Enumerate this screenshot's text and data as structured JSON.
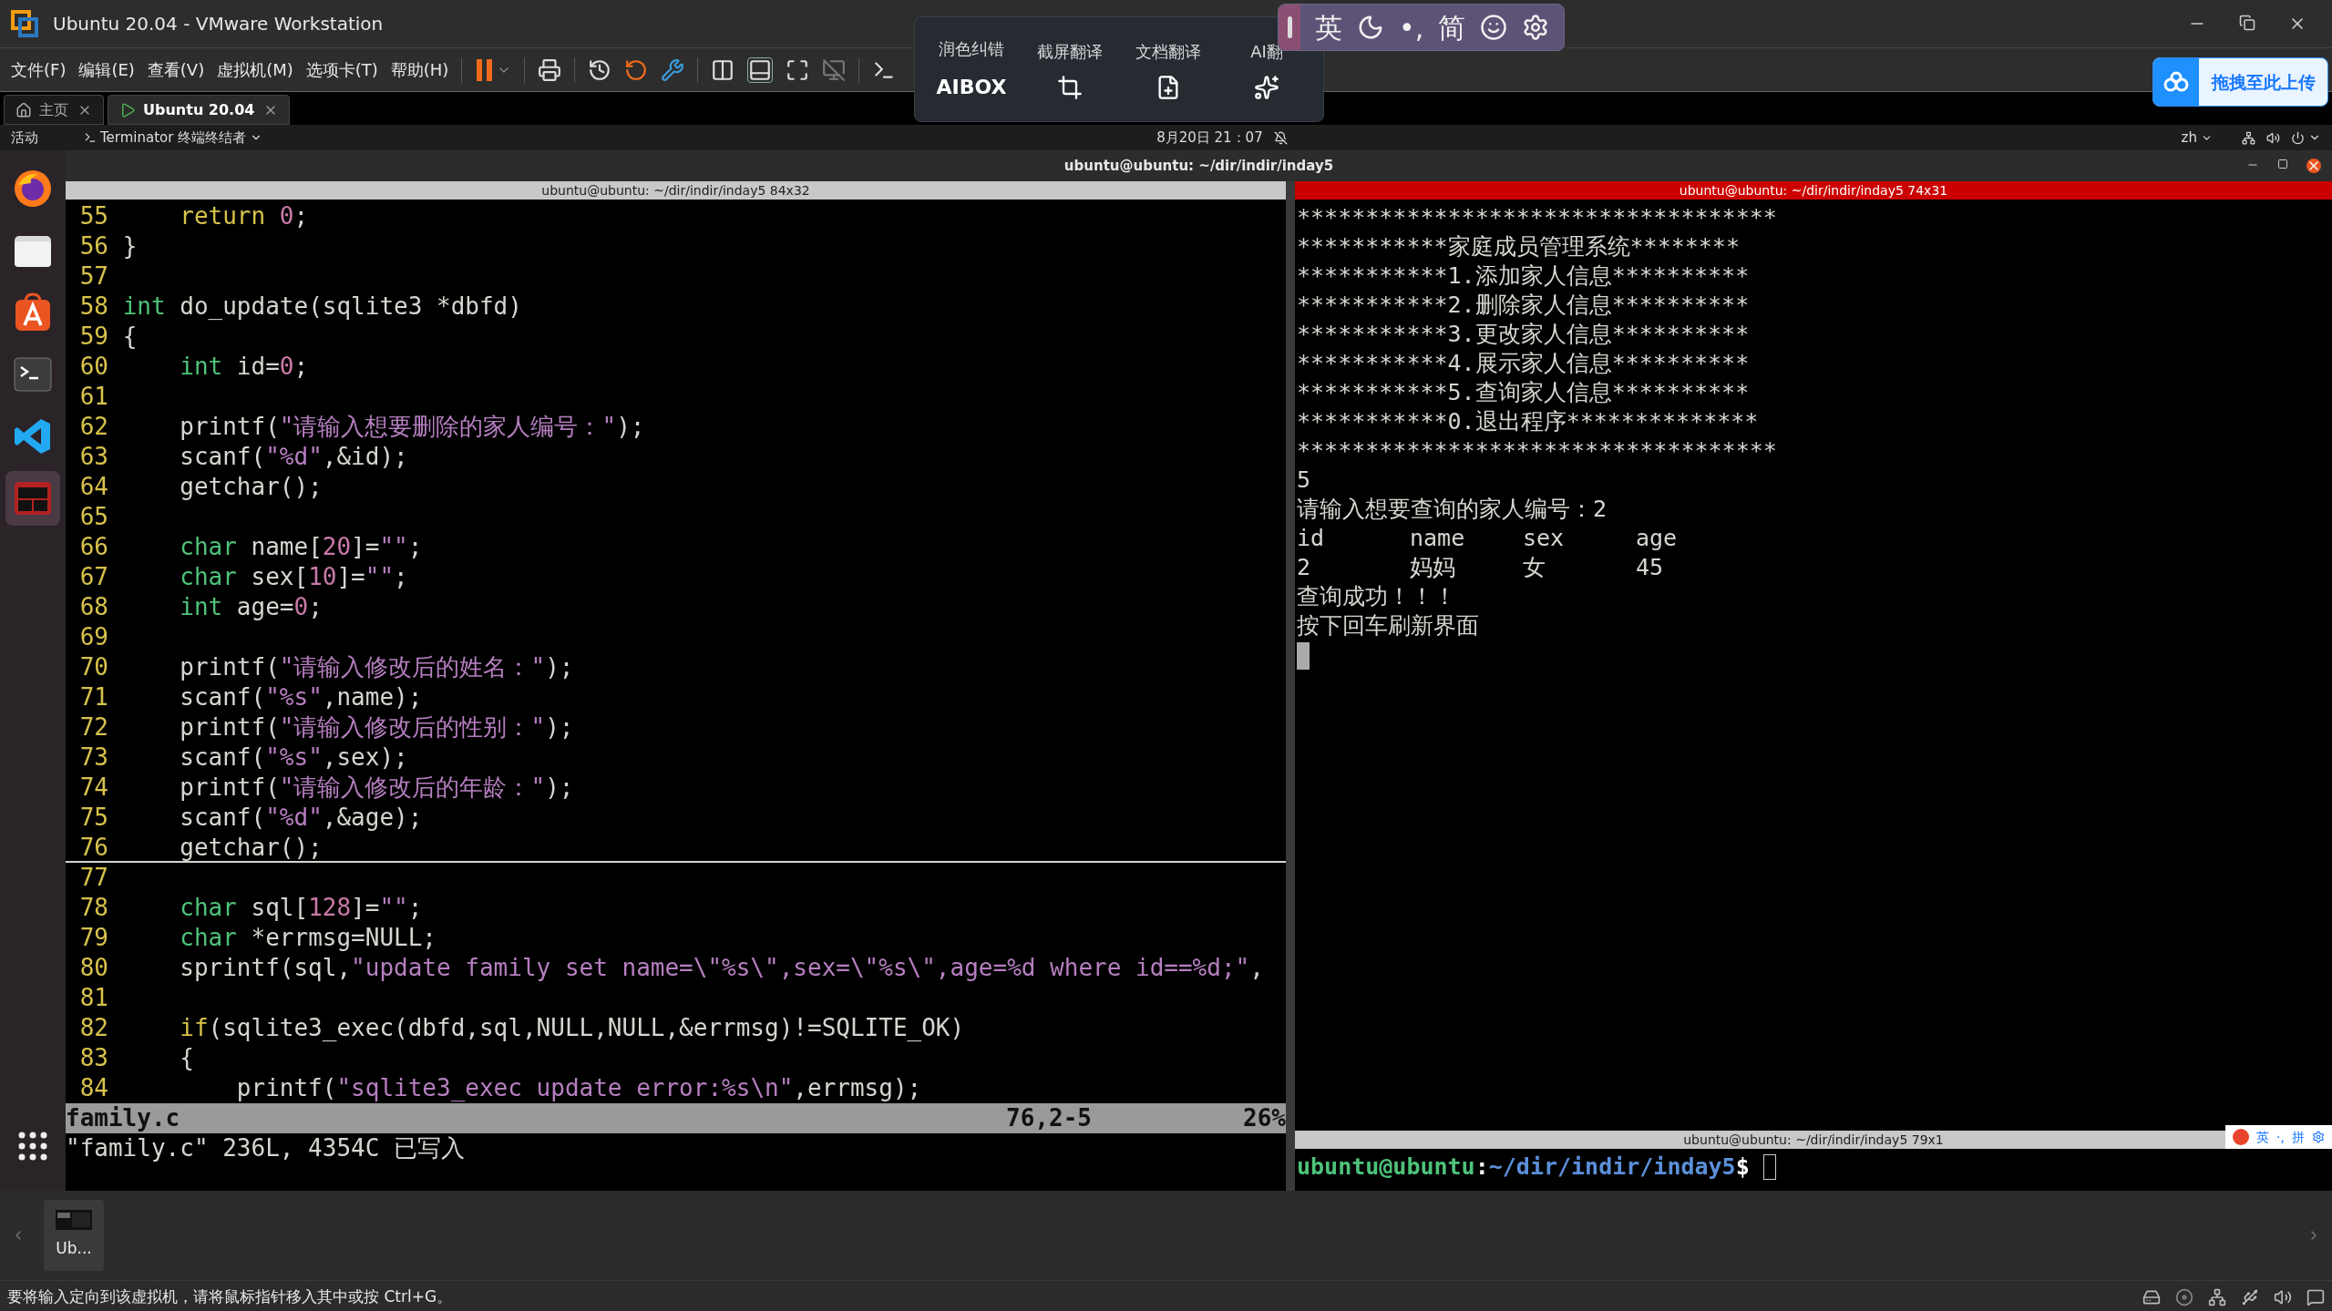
{
  "window": {
    "title": "Ubuntu 20.04 - VMware Workstation"
  },
  "menu": [
    "文件(F)",
    "编辑(E)",
    "查看(V)",
    "虚拟机(M)",
    "选项卡(T)",
    "帮助(H)"
  ],
  "translate_toolbar": [
    {
      "label": "润色纠错",
      "kind": "logo",
      "logo": "AIBOX"
    },
    {
      "label": "截屏翻译",
      "kind": "crop"
    },
    {
      "label": "文档翻译",
      "kind": "doc"
    },
    {
      "label": "AI翻",
      "kind": "ai"
    }
  ],
  "ime_bar": [
    {
      "kind": "text",
      "text": "英"
    },
    {
      "kind": "moon"
    },
    {
      "kind": "text",
      "text": "•,"
    },
    {
      "kind": "text",
      "text": "简"
    },
    {
      "kind": "smile"
    },
    {
      "kind": "gear"
    }
  ],
  "upload_button": "拖拽至此上传",
  "tabs": [
    {
      "label": "主页",
      "kind": "home",
      "selected": false
    },
    {
      "label": "Ubuntu 20.04",
      "kind": "vm",
      "selected": true
    }
  ],
  "ubuntu_topbar": {
    "activities": "活动",
    "app_menu": "Terminator 终端终结者",
    "clock": "8月20日 21：07",
    "language": "zh"
  },
  "dock": [
    {
      "kind": "firefox",
      "selected": false
    },
    {
      "kind": "files",
      "selected": false
    },
    {
      "kind": "store",
      "selected": false
    },
    {
      "kind": "terminal",
      "selected": false
    },
    {
      "kind": "vscode",
      "selected": false
    },
    {
      "kind": "terminator",
      "selected": true
    }
  ],
  "terminator": {
    "title": "ubuntu@ubuntu: ~/dir/indir/inday5",
    "left_pane": {
      "title": "ubuntu@ubuntu: ~/dir/indir/inday5 84x32",
      "focused": false,
      "lines": [
        {
          "number": "55",
          "current": false,
          "tokens": [
            {
              "kind": "keyword",
              "text": "    return"
            },
            {
              "kind": "number",
              "text": " 0"
            },
            {
              "kind": "plain",
              "text": ";"
            }
          ]
        },
        {
          "number": "56",
          "current": false,
          "tokens": [
            {
              "kind": "plain",
              "text": "}"
            }
          ]
        },
        {
          "number": "57",
          "current": false
        },
        {
          "number": "58",
          "current": false,
          "tokens": [
            {
              "kind": "type",
              "text": "int"
            },
            {
              "kind": "plain",
              "text": " do_update(sqlite3 *dbfd)"
            }
          ]
        },
        {
          "number": "59",
          "current": false,
          "tokens": [
            {
              "kind": "plain",
              "text": "{"
            }
          ]
        },
        {
          "number": "60",
          "current": false,
          "tokens": [
            {
              "kind": "type",
              "text": "    int"
            },
            {
              "kind": "plain",
              "text": " id="
            },
            {
              "kind": "number",
              "text": "0"
            },
            {
              "kind": "plain",
              "text": ";"
            }
          ]
        },
        {
          "number": "61",
          "current": false
        },
        {
          "number": "62",
          "current": false,
          "tokens": [
            {
              "kind": "plain",
              "text": "    printf("
            },
            {
              "kind": "string",
              "text": "\"请输入想要删除的家人编号：\""
            },
            {
              "kind": "plain",
              "text": ");"
            }
          ]
        },
        {
          "number": "63",
          "current": false,
          "tokens": [
            {
              "kind": "plain",
              "text": "    scanf("
            },
            {
              "kind": "string",
              "text": "\"%d\""
            },
            {
              "kind": "plain",
              "text": ",&id);"
            }
          ]
        },
        {
          "number": "64",
          "current": false,
          "tokens": [
            {
              "kind": "plain",
              "text": "    getchar();"
            }
          ]
        },
        {
          "number": "65",
          "current": false
        },
        {
          "number": "66",
          "current": false,
          "tokens": [
            {
              "kind": "type",
              "text": "    char"
            },
            {
              "kind": "plain",
              "text": " name["
            },
            {
              "kind": "number",
              "text": "20"
            },
            {
              "kind": "plain",
              "text": "]="
            },
            {
              "kind": "string",
              "text": "\"\""
            },
            {
              "kind": "plain",
              "text": ";"
            }
          ]
        },
        {
          "number": "67",
          "current": false,
          "tokens": [
            {
              "kind": "type",
              "text": "    char"
            },
            {
              "kind": "plain",
              "text": " sex["
            },
            {
              "kind": "number",
              "text": "10"
            },
            {
              "kind": "plain",
              "text": "]="
            },
            {
              "kind": "string",
              "text": "\"\""
            },
            {
              "kind": "plain",
              "text": ";"
            }
          ]
        },
        {
          "number": "68",
          "current": false,
          "tokens": [
            {
              "kind": "type",
              "text": "    int"
            },
            {
              "kind": "plain",
              "text": " age="
            },
            {
              "kind": "number",
              "text": "0"
            },
            {
              "kind": "plain",
              "text": ";"
            }
          ]
        },
        {
          "number": "69",
          "current": false
        },
        {
          "number": "70",
          "current": false,
          "tokens": [
            {
              "kind": "plain",
              "text": "    printf("
            },
            {
              "kind": "string",
              "text": "\"请输入修改后的姓名：\""
            },
            {
              "kind": "plain",
              "text": ");"
            }
          ]
        },
        {
          "number": "71",
          "current": false,
          "tokens": [
            {
              "kind": "plain",
              "text": "    scanf("
            },
            {
              "kind": "string",
              "text": "\"%s\""
            },
            {
              "kind": "plain",
              "text": ",name);"
            }
          ]
        },
        {
          "number": "72",
          "current": false,
          "tokens": [
            {
              "kind": "plain",
              "text": "    printf("
            },
            {
              "kind": "string",
              "text": "\"请输入修改后的性别：\""
            },
            {
              "kind": "plain",
              "text": ");"
            }
          ]
        },
        {
          "number": "73",
          "current": false,
          "tokens": [
            {
              "kind": "plain",
              "text": "    scanf("
            },
            {
              "kind": "string",
              "text": "\"%s\""
            },
            {
              "kind": "plain",
              "text": ",sex);"
            }
          ]
        },
        {
          "number": "74",
          "current": false,
          "tokens": [
            {
              "kind": "plain",
              "text": "    printf("
            },
            {
              "kind": "string",
              "text": "\"请输入修改后的年龄：\""
            },
            {
              "kind": "plain",
              "text": ");"
            }
          ]
        },
        {
          "number": "75",
          "current": false,
          "tokens": [
            {
              "kind": "plain",
              "text": "    scanf("
            },
            {
              "kind": "string",
              "text": "\"%d\""
            },
            {
              "kind": "plain",
              "text": ",&age);"
            }
          ]
        },
        {
          "number": "76",
          "current": true,
          "tokens": [
            {
              "kind": "plain",
              "text": "    getchar();"
            }
          ]
        },
        {
          "number": "77",
          "current": false
        },
        {
          "number": "78",
          "current": false,
          "tokens": [
            {
              "kind": "type",
              "text": "    char"
            },
            {
              "kind": "plain",
              "text": " sql["
            },
            {
              "kind": "number",
              "text": "128"
            },
            {
              "kind": "plain",
              "text": "]="
            },
            {
              "kind": "string",
              "text": "\"\""
            },
            {
              "kind": "plain",
              "text": ";"
            }
          ]
        },
        {
          "number": "79",
          "current": false,
          "tokens": [
            {
              "kind": "type",
              "text": "    char"
            },
            {
              "kind": "plain",
              "text": " *errmsg=NULL;"
            }
          ]
        },
        {
          "number": "80",
          "current": false,
          "tokens": [
            {
              "kind": "plain",
              "text": "    sprintf(sql,"
            },
            {
              "kind": "string",
              "text": "\"update family set name=\\\"%s\\\",sex=\\\"%s\\\",age=%d where id==%d;\""
            },
            {
              "kind": "plain",
              "text": ","
            }
          ]
        },
        {
          "number": "81",
          "current": false
        },
        {
          "number": "82",
          "current": false,
          "tokens": [
            {
              "kind": "keyword",
              "text": "    if"
            },
            {
              "kind": "plain",
              "text": "(sqlite3_exec(dbfd,sql,NULL,NULL,&errmsg)!=SQLITE_OK)"
            }
          ]
        },
        {
          "number": "83",
          "current": false,
          "tokens": [
            {
              "kind": "plain",
              "text": "    {"
            }
          ]
        },
        {
          "number": "84",
          "current": false,
          "tokens": [
            {
              "kind": "plain",
              "text": "        printf("
            },
            {
              "kind": "string",
              "text": "\"sqlite3_exec update error:%s\\n\""
            },
            {
              "kind": "plain",
              "text": ",errmsg);"
            }
          ]
        }
      ],
      "status": {
        "file": "family.c",
        "position": "76,2-5",
        "percent": "26%"
      },
      "message": "\"family.c\" 236L, 4354C 已写入"
    },
    "right_pane": {
      "title": "ubuntu@ubuntu: ~/dir/indir/inday5 74x31",
      "focused": true,
      "output": [
        {
          "kind": "line",
          "text": "***********************************"
        },
        {
          "kind": "line",
          "text": "***********家庭成员管理系统********"
        },
        {
          "kind": "line",
          "text": "***********1.添加家人信息**********"
        },
        {
          "kind": "line",
          "text": "***********2.删除家人信息**********"
        },
        {
          "kind": "line",
          "text": "***********3.更改家人信息**********"
        },
        {
          "kind": "line",
          "text": "***********4.展示家人信息**********"
        },
        {
          "kind": "line",
          "text": "***********5.查询家人信息**********"
        },
        {
          "kind": "line",
          "text": "***********0.退出程序**************"
        },
        {
          "kind": "line",
          "text": "***********************************"
        },
        {
          "kind": "line",
          "text": "5"
        },
        {
          "kind": "line",
          "text": "请输入想要查询的家人编号：2"
        },
        {
          "kind": "row",
          "cells": [
            "id",
            "name",
            "sex",
            "age"
          ]
        },
        {
          "kind": "row",
          "cells": [
            "2",
            "妈妈",
            "女",
            "45"
          ]
        },
        {
          "kind": "line",
          "text": "查询成功！！！"
        },
        {
          "kind": "line",
          "text": "按下回车刷新界面"
        }
      ]
    },
    "bottom_pane": {
      "title": "ubuntu@ubuntu: ~/dir/indir/inday5 79x1",
      "user": "ubuntu@ubuntu",
      "separator": ":",
      "path": "~/dir/indir/inday5",
      "end": "$"
    }
  },
  "sogou_bar": [
    "英",
    "·,",
    "拼"
  ],
  "thumbnails": [
    {
      "label": "Ub..."
    }
  ],
  "status_bar": {
    "message": "要将输入定向到该虚拟机，请将鼠标指针移入其中或按 Ctrl+G。"
  }
}
